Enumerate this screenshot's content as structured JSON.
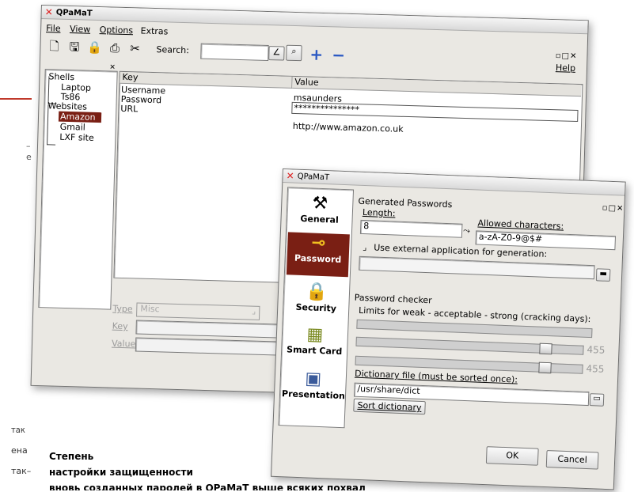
{
  "main_window": {
    "title": "QPaMaT",
    "menu": [
      "File",
      "View",
      "Options",
      "Extras"
    ],
    "search_label": "Search:",
    "help": "Help",
    "window_buttons": "▫□✕",
    "tree": {
      "groups": [
        {
          "label": "Shells",
          "children": [
            "Laptop",
            "Ts86"
          ]
        },
        {
          "label": "Websites",
          "children": [
            "Amazon",
            "Gmail",
            "LXF site"
          ]
        }
      ],
      "selected": "Amazon"
    },
    "table": {
      "columns": [
        "Key",
        "Value"
      ],
      "rows": [
        {
          "key": "Username",
          "value": "msaunders"
        },
        {
          "key": "Password",
          "value": "***************"
        },
        {
          "key": "URL",
          "value": "http://www.amazon.co.uk"
        }
      ]
    },
    "editor": {
      "type_label": "Type",
      "type_value": "Misc",
      "key_label": "Key",
      "value_label": "Value"
    }
  },
  "dialog": {
    "title": "QPaMaT",
    "window_buttons": "▫□✕",
    "nav": [
      {
        "label": "General",
        "icon": "tools-icon"
      },
      {
        "label": "Password",
        "icon": "key-icon"
      },
      {
        "label": "Security",
        "icon": "lock-icon"
      },
      {
        "label": "Smart Card",
        "icon": "smart-card-icon"
      },
      {
        "label": "Presentation",
        "icon": "presentation-icon"
      }
    ],
    "selected_nav": "Password",
    "generated_title": "Generated Passwords",
    "length_label": "Length:",
    "length_value": "8",
    "allowed_label": "Allowed characters:",
    "allowed_value": "a-zA-Z0-9@$#",
    "external_label": "Use external application for generation:",
    "checker_title": "Password checker",
    "limits_label": "Limits for weak - acceptable - strong (cracking days):",
    "slider_values": [
      "455",
      "455"
    ],
    "slider_position": 0.85,
    "dict_label": "Dictionary file (must be sorted once):",
    "dict_value": "/usr/share/dict",
    "sort_button": "Sort dictionary",
    "ok": "OK",
    "cancel": "Cancel"
  },
  "caption": {
    "left_fragments": [
      "так",
      "ена",
      "так–"
    ],
    "heading_line1": "Степень",
    "heading_line2": "настройки защищенности",
    "body_partial": "вновь созданных паролей в QPaMaT выше всяких похвал"
  },
  "colors": {
    "selection": "#7a1f14",
    "accent_rule": "#c0392b",
    "dialog_bg": "#eae8e3"
  }
}
